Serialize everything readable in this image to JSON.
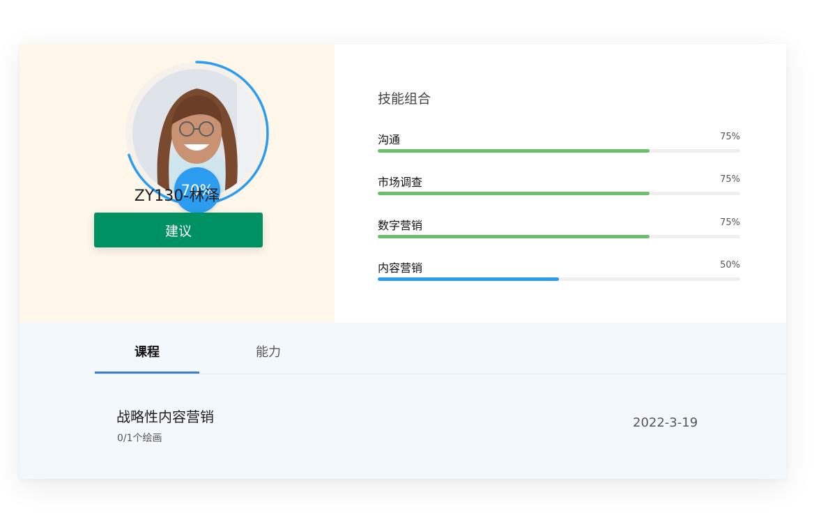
{
  "profile": {
    "name": "ZY130-林泽",
    "completion_percent": 70,
    "completion_label": "70%",
    "suggest_button_label": "建议",
    "ring_color": "#2b9cf0"
  },
  "skills": {
    "title": "技能组合",
    "items": [
      {
        "label": "沟通",
        "percent": 75,
        "percent_label": "75%",
        "color": "#6cbf6a"
      },
      {
        "label": "市场调查",
        "percent": 75,
        "percent_label": "75%",
        "color": "#6cbf6a"
      },
      {
        "label": "数字营销",
        "percent": 75,
        "percent_label": "75%",
        "color": "#6cbf6a"
      },
      {
        "label": "内容营销",
        "percent": 50,
        "percent_label": "50%",
        "color": "#2b9cf0"
      }
    ]
  },
  "tabs": [
    {
      "label": "课程",
      "active": true
    },
    {
      "label": "能力",
      "active": false
    }
  ],
  "course": {
    "title": "战略性内容营销",
    "progress_text": "0/1个绘画",
    "date": "2022-3-19"
  },
  "colors": {
    "left_panel_bg": "#fff7ea",
    "bottom_panel_bg": "#f3f8fd",
    "button_bg": "#009163",
    "tab_underline": "#3a7fd0"
  }
}
